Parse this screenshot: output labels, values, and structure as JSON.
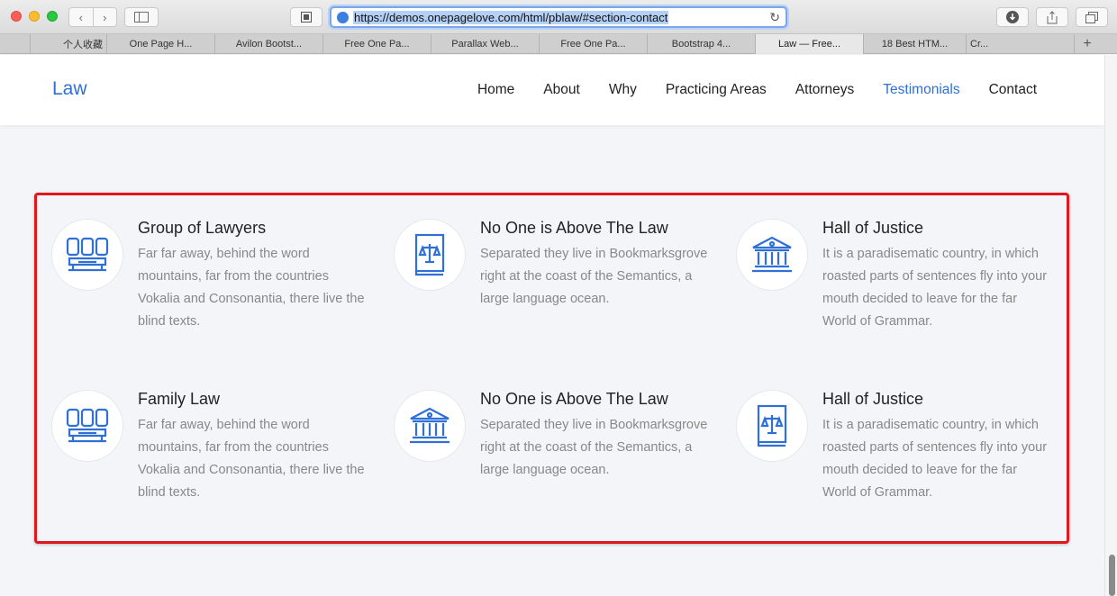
{
  "browser": {
    "url": "https://demos.onepagelove.com/html/pblaw/#section-contact",
    "tabs": [
      {
        "label": "",
        "active": false
      },
      {
        "label": "个人收藏",
        "active": false
      },
      {
        "label": "One Page H...",
        "active": false
      },
      {
        "label": "Avilon Bootst...",
        "active": false
      },
      {
        "label": "Free One Pa...",
        "active": false
      },
      {
        "label": "Parallax Web...",
        "active": false
      },
      {
        "label": "Free One Pa...",
        "active": false
      },
      {
        "label": "Bootstrap 4...",
        "active": false
      },
      {
        "label": "Law — Free...",
        "active": true
      },
      {
        "label": "18 Best HTM...",
        "active": false
      },
      {
        "label": "Cr...",
        "active": false
      }
    ]
  },
  "header": {
    "brand": "Law",
    "menu": [
      {
        "label": "Home",
        "active": false
      },
      {
        "label": "About",
        "active": false
      },
      {
        "label": "Why",
        "active": false
      },
      {
        "label": "Practicing Areas",
        "active": false
      },
      {
        "label": "Attorneys",
        "active": false
      },
      {
        "label": "Testimonials",
        "active": true
      },
      {
        "label": "Contact",
        "active": false
      }
    ]
  },
  "services": [
    {
      "icon": "lawyers-group-icon",
      "title": "Group of Lawyers",
      "text": "Far far away, behind the word mountains, far from the countries Vokalia and Consonantia, there live the blind texts."
    },
    {
      "icon": "law-book-icon",
      "title": "No One is Above The Law",
      "text": "Separated they live in Bookmarksgrove right at the coast of the Semantics, a large language ocean."
    },
    {
      "icon": "courthouse-icon",
      "title": "Hall of Justice",
      "text": "It is a paradisematic country, in which roasted parts of sentences fly into your mouth decided to leave for the far World of Grammar."
    },
    {
      "icon": "lawyers-group-icon",
      "title": "Family Law",
      "text": "Far far away, behind the word mountains, far from the countries Vokalia and Consonantia, there live the blind texts."
    },
    {
      "icon": "courthouse-icon",
      "title": "No One is Above The Law",
      "text": "Separated they live in Bookmarksgrove right at the coast of the Semantics, a large language ocean."
    },
    {
      "icon": "law-book-icon",
      "title": "Hall of Justice",
      "text": "It is a paradisematic country, in which roasted parts of sentences fly into your mouth decided to leave for the far World of Grammar."
    }
  ],
  "colors": {
    "accent": "#2f6fd6",
    "highlight": "#e0171d",
    "icon": "#2f6fd6"
  }
}
